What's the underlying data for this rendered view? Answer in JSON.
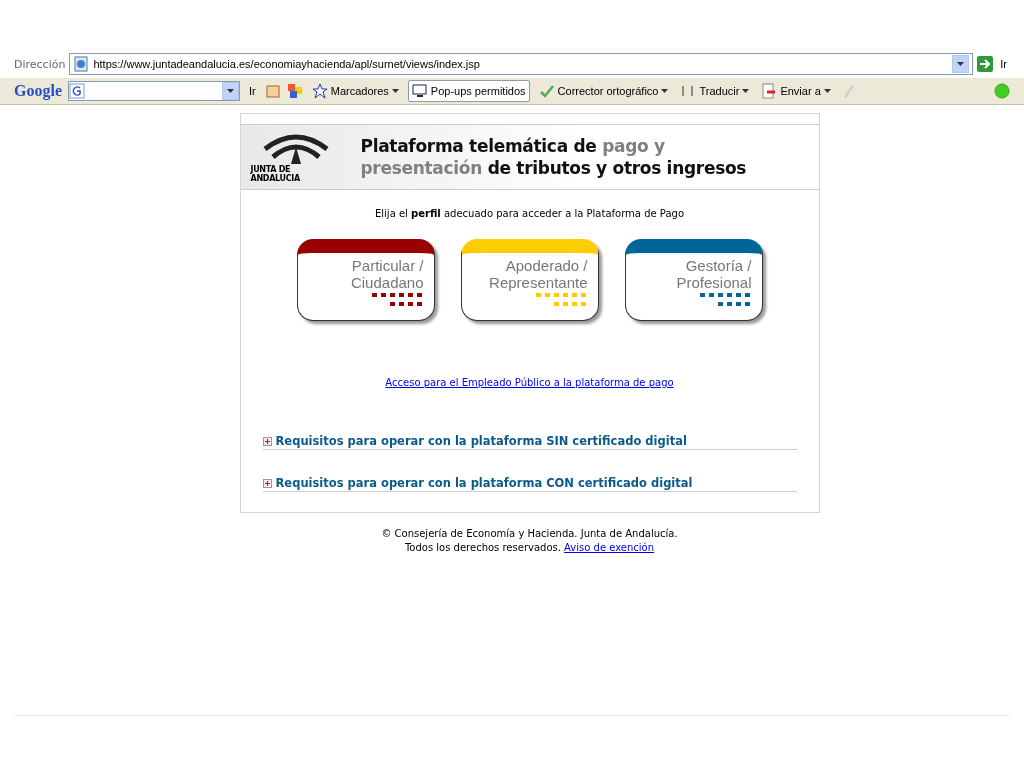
{
  "address_bar": {
    "label": "Dirección",
    "url": "https://www.juntadeandalucia.es/economiayhacienda/apl/surnet/views/index.jsp",
    "go": "Ir"
  },
  "google_toolbar": {
    "logo": "Google",
    "search_button": "Ir",
    "bookmarks": "Marcadores",
    "popups": "Pop-ups permitidos",
    "spellcheck": "Corrector ortográfico",
    "translate": "Traducir",
    "send": "Enviar a"
  },
  "header": {
    "logo_text": "JUNTA DE ANDALUCIA",
    "title_lines": [
      [
        {
          "text": "Plataforma telemática de ",
          "kind": "dark"
        },
        {
          "text": "pago y",
          "kind": "grey"
        }
      ],
      [
        {
          "text": "presentación",
          "kind": "grey"
        },
        {
          "text": " de tributos y otros ingresos",
          "kind": "dark"
        }
      ]
    ]
  },
  "intro": "Elija el **perfil** adecuado para acceder a la Plataforma de Pago",
  "profiles": [
    {
      "line1": "Particular /",
      "line2": "Ciudadano",
      "color": "#990000"
    },
    {
      "line1": "Apoderado /",
      "line2": "Representante",
      "color": "#ffcc00"
    },
    {
      "line1": "Gestoría /",
      "line2": "Profesional",
      "color": "#006699"
    }
  ],
  "employee_link": "Acceso para el Empleado Público a la plataforma de pago",
  "requirements": [
    {
      "label": "Requisitos para operar con la plataforma SIN certificado digital",
      "expanded": false
    },
    {
      "label": "Requisitos para operar con la plataforma CON certificado digital",
      "expanded": false
    }
  ],
  "footer": {
    "line1": "© Consejería de Economía y Hacienda. Junta de Andalucía.",
    "line2": "Todos los derechos reservados.",
    "link": "Aviso de exención"
  }
}
